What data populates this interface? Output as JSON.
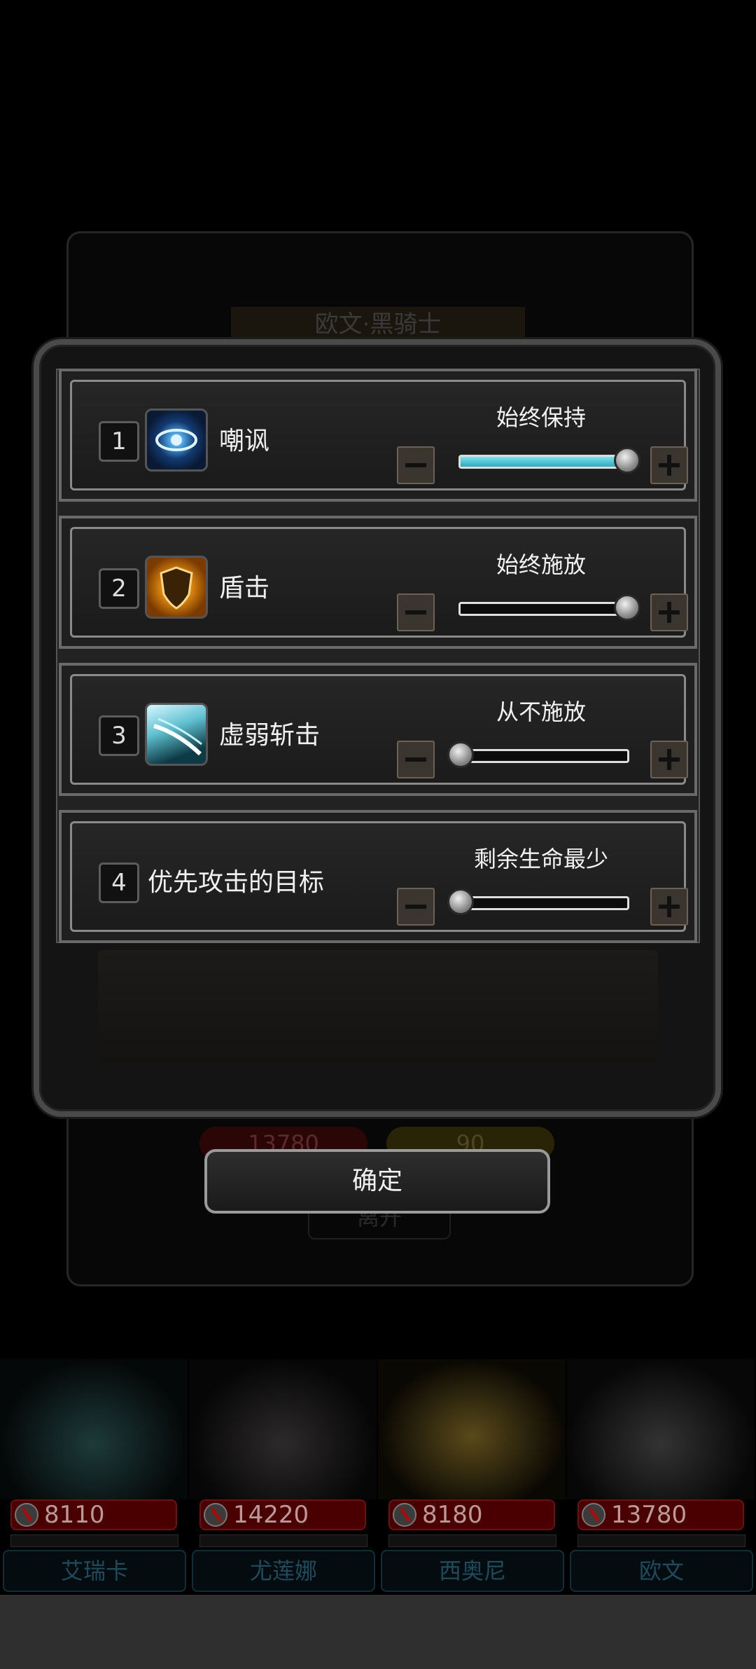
{
  "background": {
    "hero_title": "欧文·黑骑士",
    "hp_value": "13780",
    "energy_value": "90",
    "leave_label": "离开"
  },
  "dialog": {
    "rows": [
      {
        "index": "1",
        "skill": "嘲讽",
        "mode": "始终保持",
        "level": 1.0,
        "icon": "eye-icon"
      },
      {
        "index": "2",
        "skill": "盾击",
        "mode": "始终施放",
        "level": 1.0,
        "icon": "shield-icon"
      },
      {
        "index": "3",
        "skill": "虚弱斩击",
        "mode": "从不施放",
        "level": 0.0,
        "icon": "slash-icon"
      },
      {
        "index": "4",
        "skill": "优先攻击的目标",
        "mode": "剩余生命最少",
        "level": 0.0,
        "icon": null
      }
    ],
    "confirm_label": "确定"
  },
  "heroes": [
    {
      "name": "艾瑞卡",
      "hp": "8110"
    },
    {
      "name": "尤莲娜",
      "hp": "14220"
    },
    {
      "name": "西奥尼",
      "hp": "8180"
    },
    {
      "name": "欧文",
      "hp": "13780"
    }
  ],
  "colors": {
    "slider_fill": "#4cc8d8",
    "hp_red": "#8b0000",
    "name_teal": "#1c4c5c"
  }
}
